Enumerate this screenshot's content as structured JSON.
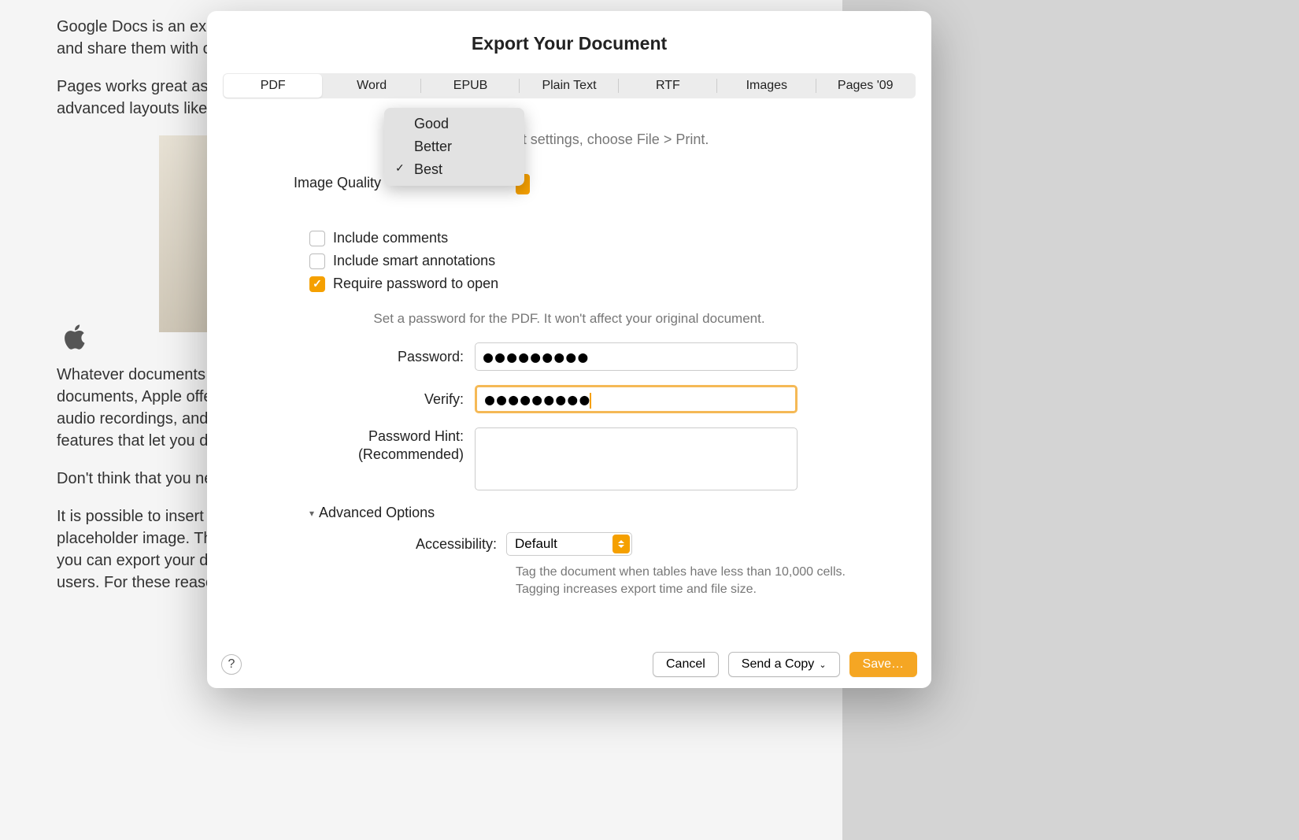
{
  "background": {
    "p1": "Google Docs is an excellent word processor that gives you the ability to collaborate on your documents and share them with others. It's a purely web-based program that is designed for text-based documents.",
    "p2": "Pages works great as a document processor, but it also has some tools that let you produce more advanced layouts like newsletters and flyers. In Google Docs, multi-column layout is more limited.",
    "p3": "Whatever documents you are working on, Pages has you covered. While unavailable for web-based documents, Apple offers the option of inserting media files. You can even embed YouTube videos, add audio recordings, and watch any video in your document. This is multimedia. And there are even features that let you drag and drop media right onto the page.",
    "p4": "Don't think that you need to do all of your work in Pages. You can easily import files into any file.",
    "p5": "It is possible to insert media files into Google Docs, but you are not going to get anything more than a placeholder image. The way Pages handles media – videos make the appearing in a popup window and you can export your documents to several different extensions to match the needs of other apps or users. For these reasons, Apple Pages is much better for creating feature-rich documents."
  },
  "dialog": {
    "title": "Export Your Document",
    "tabs": [
      "PDF",
      "Word",
      "EPUB",
      "Plain Text",
      "RTF",
      "Images",
      "Pages '09"
    ],
    "active_tab": "PDF",
    "print_hint": "t settings, choose File > Print.",
    "image_quality_label": "Image Quality",
    "quality_options": [
      "Good",
      "Better",
      "Best"
    ],
    "quality_selected": "Best",
    "checkboxes": {
      "include_comments": "Include comments",
      "include_annotations": "Include smart annotations",
      "require_password": "Require password to open"
    },
    "password_note": "Set a password for the PDF. It won't affect your original document.",
    "labels": {
      "password": "Password:",
      "verify": "Verify:",
      "hint": "Password Hint:",
      "hint2": "(Recommended)"
    },
    "password_value": "●●●●●●●●●",
    "verify_value": "●●●●●●●●●",
    "advanced_label": "Advanced Options",
    "accessibility_label": "Accessibility:",
    "accessibility_value": "Default",
    "accessibility_note": "Tag the document when tables have less than 10,000 cells. Tagging increases export time and file size.",
    "buttons": {
      "help": "?",
      "cancel": "Cancel",
      "send": "Send a Copy",
      "save": "Save…"
    }
  }
}
